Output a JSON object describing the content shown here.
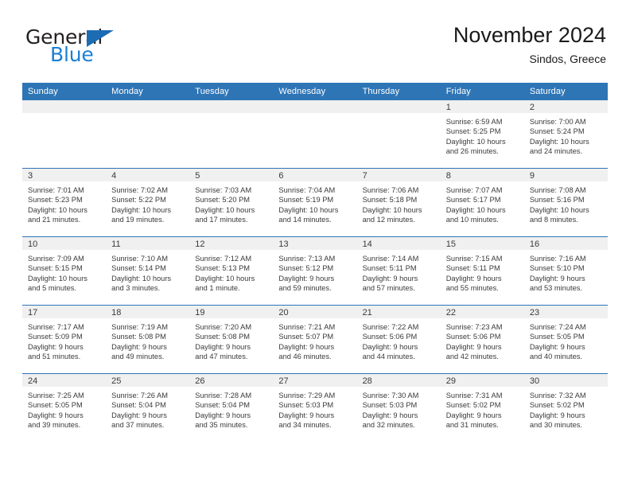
{
  "brand": {
    "word1": "General",
    "word2": "Blue",
    "triangle_color": "#1b6cb3",
    "blue_text_color": "#1b7fd4"
  },
  "header": {
    "title": "November 2024",
    "subtitle": "Sindos, Greece"
  },
  "theme": {
    "header_bg": "#2e75b6",
    "header_text": "#ffffff",
    "daynum_bg": "#f0f0f0",
    "cell_bg": "#ffffff",
    "text": "#3a3a3a"
  },
  "weekdays": [
    "Sunday",
    "Monday",
    "Tuesday",
    "Wednesday",
    "Thursday",
    "Friday",
    "Saturday"
  ],
  "weeks": [
    [
      {
        "day": "",
        "sunrise": "",
        "sunset": "",
        "daylight1": "",
        "daylight2": ""
      },
      {
        "day": "",
        "sunrise": "",
        "sunset": "",
        "daylight1": "",
        "daylight2": ""
      },
      {
        "day": "",
        "sunrise": "",
        "sunset": "",
        "daylight1": "",
        "daylight2": ""
      },
      {
        "day": "",
        "sunrise": "",
        "sunset": "",
        "daylight1": "",
        "daylight2": ""
      },
      {
        "day": "",
        "sunrise": "",
        "sunset": "",
        "daylight1": "",
        "daylight2": ""
      },
      {
        "day": "1",
        "sunrise": "Sunrise: 6:59 AM",
        "sunset": "Sunset: 5:25 PM",
        "daylight1": "Daylight: 10 hours",
        "daylight2": "and 26 minutes."
      },
      {
        "day": "2",
        "sunrise": "Sunrise: 7:00 AM",
        "sunset": "Sunset: 5:24 PM",
        "daylight1": "Daylight: 10 hours",
        "daylight2": "and 24 minutes."
      }
    ],
    [
      {
        "day": "3",
        "sunrise": "Sunrise: 7:01 AM",
        "sunset": "Sunset: 5:23 PM",
        "daylight1": "Daylight: 10 hours",
        "daylight2": "and 21 minutes."
      },
      {
        "day": "4",
        "sunrise": "Sunrise: 7:02 AM",
        "sunset": "Sunset: 5:22 PM",
        "daylight1": "Daylight: 10 hours",
        "daylight2": "and 19 minutes."
      },
      {
        "day": "5",
        "sunrise": "Sunrise: 7:03 AM",
        "sunset": "Sunset: 5:20 PM",
        "daylight1": "Daylight: 10 hours",
        "daylight2": "and 17 minutes."
      },
      {
        "day": "6",
        "sunrise": "Sunrise: 7:04 AM",
        "sunset": "Sunset: 5:19 PM",
        "daylight1": "Daylight: 10 hours",
        "daylight2": "and 14 minutes."
      },
      {
        "day": "7",
        "sunrise": "Sunrise: 7:06 AM",
        "sunset": "Sunset: 5:18 PM",
        "daylight1": "Daylight: 10 hours",
        "daylight2": "and 12 minutes."
      },
      {
        "day": "8",
        "sunrise": "Sunrise: 7:07 AM",
        "sunset": "Sunset: 5:17 PM",
        "daylight1": "Daylight: 10 hours",
        "daylight2": "and 10 minutes."
      },
      {
        "day": "9",
        "sunrise": "Sunrise: 7:08 AM",
        "sunset": "Sunset: 5:16 PM",
        "daylight1": "Daylight: 10 hours",
        "daylight2": "and 8 minutes."
      }
    ],
    [
      {
        "day": "10",
        "sunrise": "Sunrise: 7:09 AM",
        "sunset": "Sunset: 5:15 PM",
        "daylight1": "Daylight: 10 hours",
        "daylight2": "and 5 minutes."
      },
      {
        "day": "11",
        "sunrise": "Sunrise: 7:10 AM",
        "sunset": "Sunset: 5:14 PM",
        "daylight1": "Daylight: 10 hours",
        "daylight2": "and 3 minutes."
      },
      {
        "day": "12",
        "sunrise": "Sunrise: 7:12 AM",
        "sunset": "Sunset: 5:13 PM",
        "daylight1": "Daylight: 10 hours",
        "daylight2": "and 1 minute."
      },
      {
        "day": "13",
        "sunrise": "Sunrise: 7:13 AM",
        "sunset": "Sunset: 5:12 PM",
        "daylight1": "Daylight: 9 hours",
        "daylight2": "and 59 minutes."
      },
      {
        "day": "14",
        "sunrise": "Sunrise: 7:14 AM",
        "sunset": "Sunset: 5:11 PM",
        "daylight1": "Daylight: 9 hours",
        "daylight2": "and 57 minutes."
      },
      {
        "day": "15",
        "sunrise": "Sunrise: 7:15 AM",
        "sunset": "Sunset: 5:11 PM",
        "daylight1": "Daylight: 9 hours",
        "daylight2": "and 55 minutes."
      },
      {
        "day": "16",
        "sunrise": "Sunrise: 7:16 AM",
        "sunset": "Sunset: 5:10 PM",
        "daylight1": "Daylight: 9 hours",
        "daylight2": "and 53 minutes."
      }
    ],
    [
      {
        "day": "17",
        "sunrise": "Sunrise: 7:17 AM",
        "sunset": "Sunset: 5:09 PM",
        "daylight1": "Daylight: 9 hours",
        "daylight2": "and 51 minutes."
      },
      {
        "day": "18",
        "sunrise": "Sunrise: 7:19 AM",
        "sunset": "Sunset: 5:08 PM",
        "daylight1": "Daylight: 9 hours",
        "daylight2": "and 49 minutes."
      },
      {
        "day": "19",
        "sunrise": "Sunrise: 7:20 AM",
        "sunset": "Sunset: 5:08 PM",
        "daylight1": "Daylight: 9 hours",
        "daylight2": "and 47 minutes."
      },
      {
        "day": "20",
        "sunrise": "Sunrise: 7:21 AM",
        "sunset": "Sunset: 5:07 PM",
        "daylight1": "Daylight: 9 hours",
        "daylight2": "and 46 minutes."
      },
      {
        "day": "21",
        "sunrise": "Sunrise: 7:22 AM",
        "sunset": "Sunset: 5:06 PM",
        "daylight1": "Daylight: 9 hours",
        "daylight2": "and 44 minutes."
      },
      {
        "day": "22",
        "sunrise": "Sunrise: 7:23 AM",
        "sunset": "Sunset: 5:06 PM",
        "daylight1": "Daylight: 9 hours",
        "daylight2": "and 42 minutes."
      },
      {
        "day": "23",
        "sunrise": "Sunrise: 7:24 AM",
        "sunset": "Sunset: 5:05 PM",
        "daylight1": "Daylight: 9 hours",
        "daylight2": "and 40 minutes."
      }
    ],
    [
      {
        "day": "24",
        "sunrise": "Sunrise: 7:25 AM",
        "sunset": "Sunset: 5:05 PM",
        "daylight1": "Daylight: 9 hours",
        "daylight2": "and 39 minutes."
      },
      {
        "day": "25",
        "sunrise": "Sunrise: 7:26 AM",
        "sunset": "Sunset: 5:04 PM",
        "daylight1": "Daylight: 9 hours",
        "daylight2": "and 37 minutes."
      },
      {
        "day": "26",
        "sunrise": "Sunrise: 7:28 AM",
        "sunset": "Sunset: 5:04 PM",
        "daylight1": "Daylight: 9 hours",
        "daylight2": "and 35 minutes."
      },
      {
        "day": "27",
        "sunrise": "Sunrise: 7:29 AM",
        "sunset": "Sunset: 5:03 PM",
        "daylight1": "Daylight: 9 hours",
        "daylight2": "and 34 minutes."
      },
      {
        "day": "28",
        "sunrise": "Sunrise: 7:30 AM",
        "sunset": "Sunset: 5:03 PM",
        "daylight1": "Daylight: 9 hours",
        "daylight2": "and 32 minutes."
      },
      {
        "day": "29",
        "sunrise": "Sunrise: 7:31 AM",
        "sunset": "Sunset: 5:02 PM",
        "daylight1": "Daylight: 9 hours",
        "daylight2": "and 31 minutes."
      },
      {
        "day": "30",
        "sunrise": "Sunrise: 7:32 AM",
        "sunset": "Sunset: 5:02 PM",
        "daylight1": "Daylight: 9 hours",
        "daylight2": "and 30 minutes."
      }
    ]
  ]
}
